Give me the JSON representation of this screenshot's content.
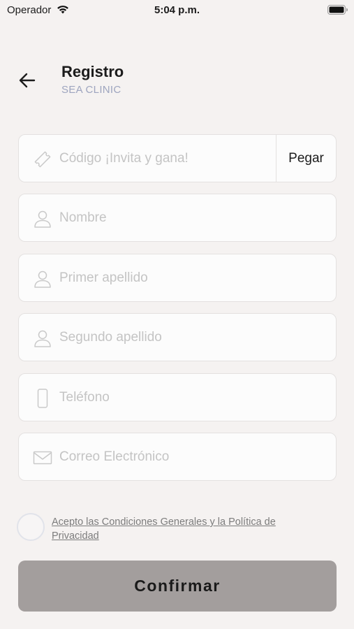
{
  "status_bar": {
    "carrier": "Operador",
    "time": "5:04 p.m.",
    "wifi_icon": "wifi-icon",
    "battery_icon": "battery-icon"
  },
  "header": {
    "back_icon": "arrow-left-icon",
    "title": "Registro",
    "subtitle": "SEA CLINIC"
  },
  "form": {
    "code": {
      "placeholder": "Código ¡Invita y gana!",
      "value": "",
      "icon": "ticket-icon",
      "paste_label": "Pegar"
    },
    "name": {
      "placeholder": "Nombre",
      "value": "",
      "icon": "user-icon"
    },
    "first_surname": {
      "placeholder": "Primer apellido",
      "value": "",
      "icon": "user-icon"
    },
    "second_surname": {
      "placeholder": "Segundo apellido",
      "value": "",
      "icon": "user-icon"
    },
    "phone": {
      "placeholder": "Teléfono",
      "value": "",
      "icon": "phone-icon"
    },
    "email": {
      "placeholder": "Correo Electrónico",
      "value": "",
      "icon": "envelope-icon"
    }
  },
  "terms": {
    "checked": false,
    "label": "Acepto las Condiciones Generales y la Política de Privacidad"
  },
  "confirm_label": "Confirmar",
  "colors": {
    "background": "#f5f2f1",
    "field_border": "#e4e1e0",
    "subtitle": "#9ea5bf",
    "button": "#a39e9d",
    "placeholder": "#c4c4c4"
  }
}
